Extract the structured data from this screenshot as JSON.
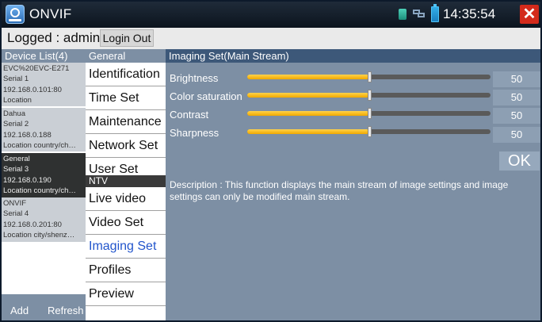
{
  "titlebar": {
    "app_title": "ONVIF",
    "time": "14:35:54",
    "close_symbol": "✕",
    "icons": [
      "app-logo-icon",
      "sim-card-icon",
      "network-icon",
      "battery-icon",
      "close-icon"
    ]
  },
  "login": {
    "logged_text": "Logged : admin",
    "logout_label": "Login Out"
  },
  "device_list": {
    "header": "Device List(4)",
    "devices": [
      {
        "name": "EVC%20EVC-E271",
        "serial": "Serial 1",
        "ip": "192.168.0.101:80",
        "location": "Location",
        "selected": false
      },
      {
        "name": "Dahua",
        "serial": "Serial 2",
        "ip": "192.168.0.188",
        "location": "Location country/ch…",
        "selected": false
      },
      {
        "name": "General",
        "serial": "Serial 3",
        "ip": "192.168.0.190",
        "location": "Location country/ch…",
        "selected": true
      },
      {
        "name": "ONVIF",
        "serial": "Serial 4",
        "ip": "192.168.0.201:80",
        "location": "Location city/shenz…",
        "selected": false
      }
    ],
    "add_label": "Add",
    "refresh_label": "Refresh"
  },
  "menu": {
    "general_header": "General",
    "general_items": [
      "Identification",
      "Time Set",
      "Maintenance",
      "Network Set",
      "User Set"
    ],
    "ntv_header": "NTV",
    "ntv_items": [
      "Live video",
      "Video Set",
      "Imaging Set",
      "Profiles",
      "Preview"
    ],
    "active_item": "Imaging Set"
  },
  "imaging": {
    "header": "Imaging Set(Main Stream)",
    "settings": [
      {
        "label": "Brightness",
        "value": "50",
        "level": 0.5
      },
      {
        "label": "Color saturation",
        "value": "50",
        "level": 0.5
      },
      {
        "label": "Contrast",
        "value": "50",
        "level": 0.5
      },
      {
        "label": "Sharpness",
        "value": "50",
        "level": 0.5
      }
    ],
    "ok_label": "OK",
    "description": "Description : This function displays the main stream of image settings and image settings can only be modified main stream."
  },
  "colors": {
    "accent_slider": "#f5b800",
    "active_menu": "#2255cc",
    "close_button": "#d32a1b"
  }
}
